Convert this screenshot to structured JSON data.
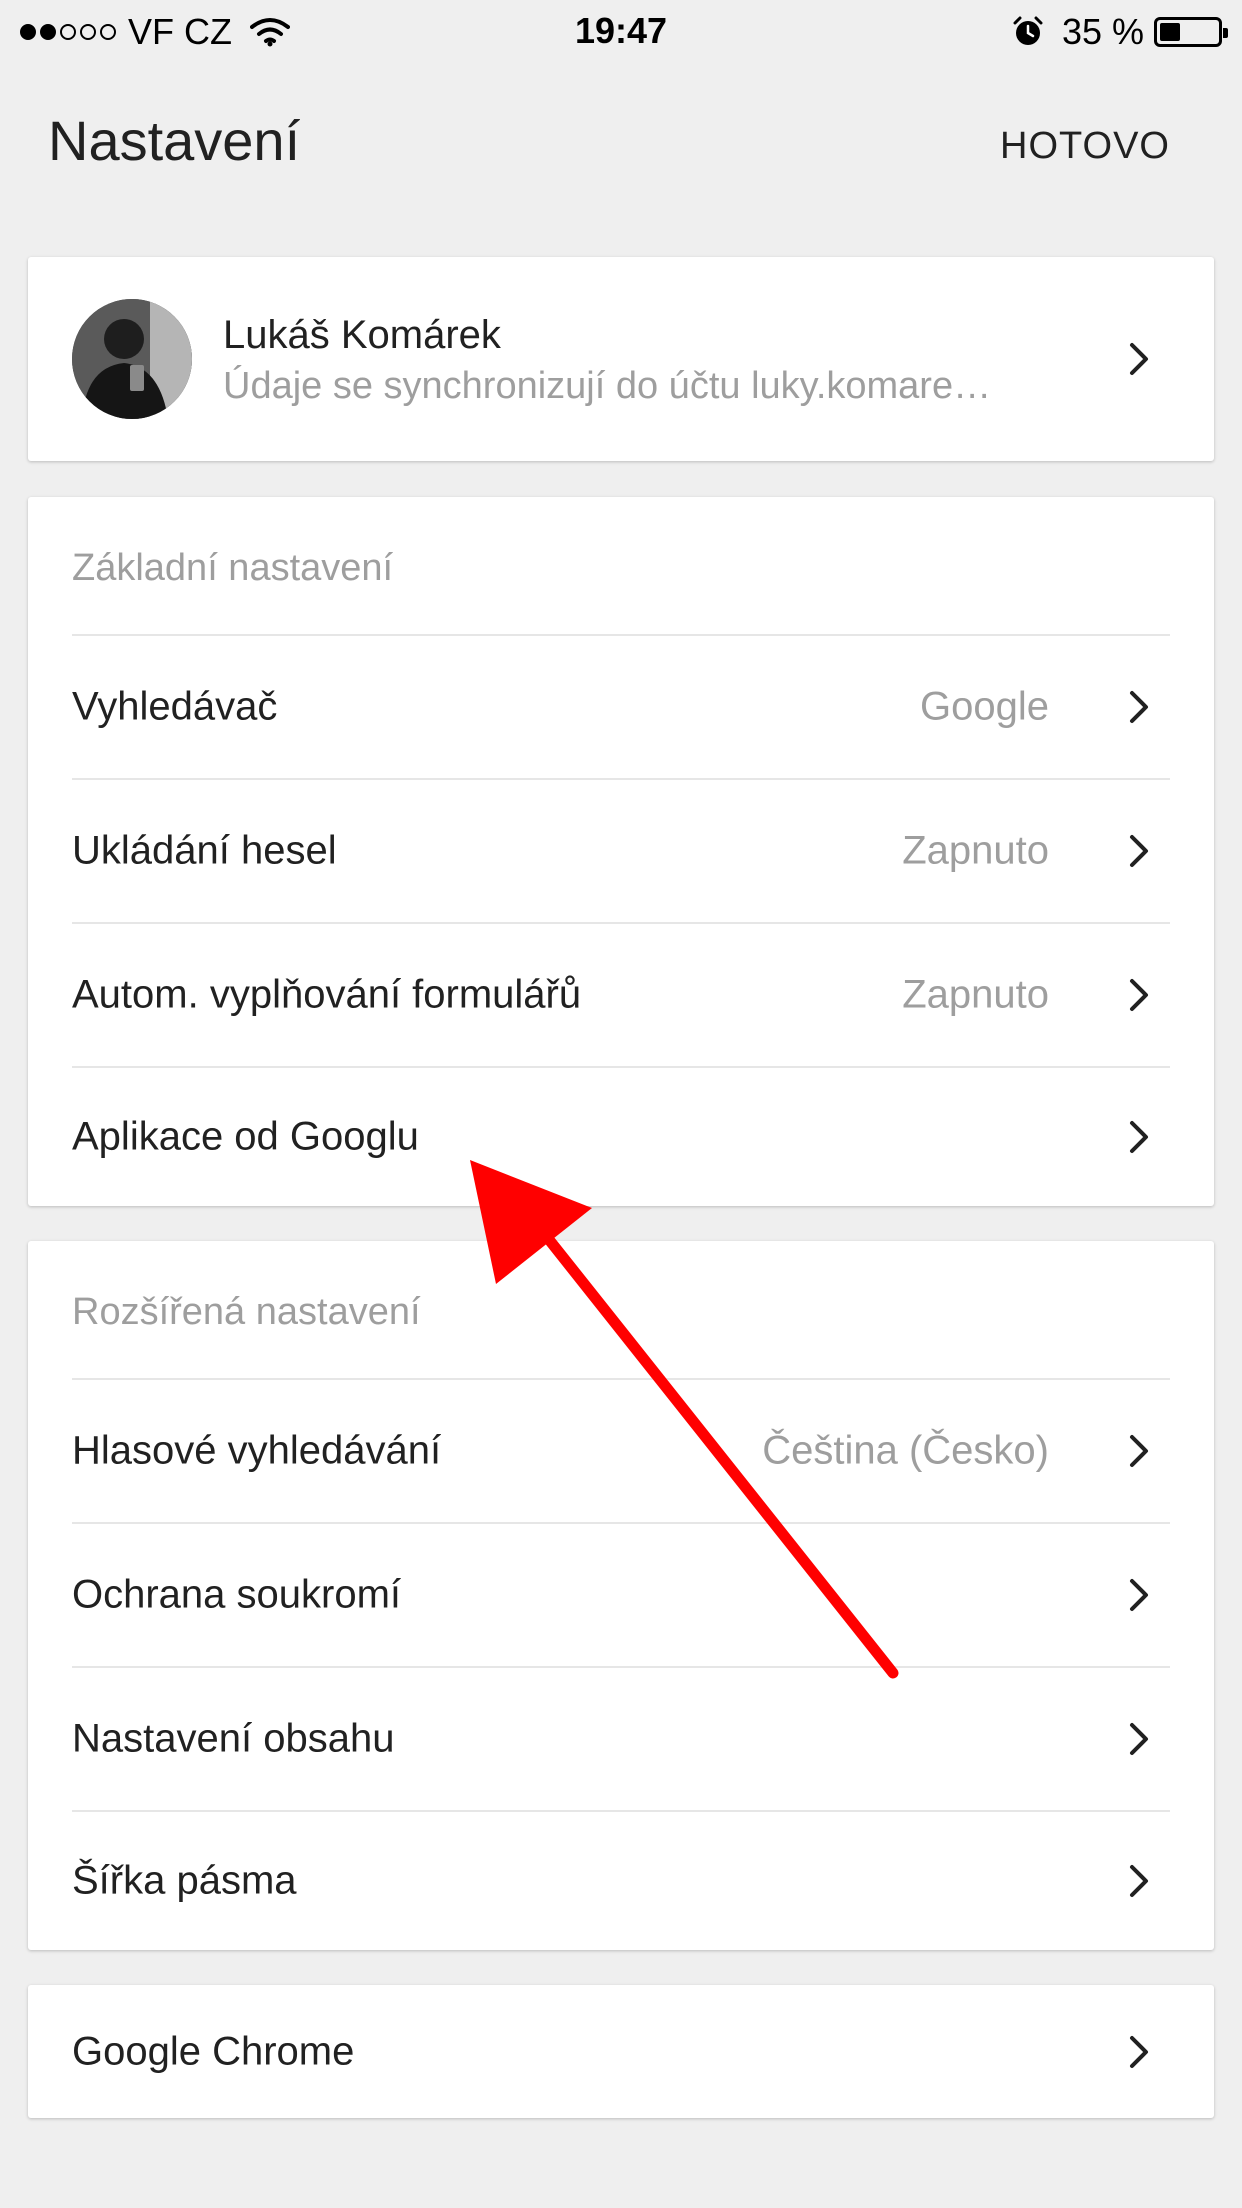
{
  "status_bar": {
    "carrier": "VF CZ",
    "time": "19:47",
    "battery": "35 %",
    "battery_level": 0.35,
    "signal_bars_filled": 2,
    "signal_bars_total": 5
  },
  "header": {
    "title": "Nastavení",
    "done_label": "HOTOVO"
  },
  "account": {
    "name": "Lukáš Komárek",
    "subtitle": "Údaje se synchronizují do účtu luky.komare…"
  },
  "basic_settings": {
    "header": "Základní nastavení",
    "items": [
      {
        "label": "Vyhledávač",
        "value": "Google"
      },
      {
        "label": "Ukládání hesel",
        "value": "Zapnuto"
      },
      {
        "label": "Autom. vyplňování formulářů",
        "value": "Zapnuto"
      },
      {
        "label": "Aplikace od Googlu",
        "value": ""
      }
    ]
  },
  "advanced_settings": {
    "header": "Rozšířená nastavení",
    "items": [
      {
        "label": "Hlasové vyhledávání",
        "value": "Čeština (Česko)"
      },
      {
        "label": "Ochrana soukromí",
        "value": ""
      },
      {
        "label": "Nastavení obsahu",
        "value": ""
      },
      {
        "label": "Šířka pásma",
        "value": ""
      }
    ]
  },
  "about": {
    "label": "Google Chrome"
  },
  "colors": {
    "background": "#efefef",
    "card": "#ffffff",
    "primary_text": "#212121",
    "secondary_text": "#9e9e9e",
    "annotation_arrow": "#ff0000"
  },
  "icons": {
    "chevron": "chevron-right-icon",
    "wifi": "wifi-icon",
    "alarm": "alarm-icon",
    "battery": "battery-icon"
  }
}
